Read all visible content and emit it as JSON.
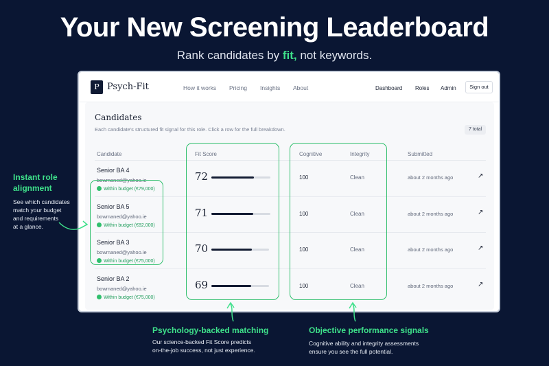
{
  "hero": {
    "title": "Your New Screening Leaderboard",
    "subtitle_pre": "Rank candidates by ",
    "subtitle_accent": "fit,",
    "subtitle_post": " not keywords."
  },
  "app": {
    "logo_letter": "P",
    "brand": "Psych-Fit",
    "nav_links": [
      "How it works",
      "Pricing",
      "Insights",
      "About"
    ],
    "nav_right": [
      "Dashboard",
      "Roles",
      "Admin"
    ],
    "signout_label": "Sign out"
  },
  "candidates": {
    "title": "Candidates",
    "description": "Each candidate's structured fit signal for this role. Click a row for the full breakdown.",
    "total_badge": "7 total",
    "headers": {
      "candidate": "Candidate",
      "fit_score": "Fit Score",
      "cognitive": "Cognitive",
      "integrity": "Integrity",
      "submitted": "Submitted"
    },
    "rows": [
      {
        "name": "Senior BA 4",
        "email": "bowmaned@yahoo.ie",
        "budget": "Within budget (€79,000)",
        "score": "72",
        "score_value": 72,
        "cognitive": "100",
        "integrity": "Clean",
        "submitted": "about 2 months ago",
        "arrow": "↗"
      },
      {
        "name": "Senior BA 5",
        "email": "bowmaned@yahoo.ie",
        "budget": "Within budget (€82,000)",
        "score": "71",
        "score_value": 71,
        "cognitive": "100",
        "integrity": "Clean",
        "submitted": "about 2 months ago",
        "arrow": "↗"
      },
      {
        "name": "Senior BA 3",
        "email": "bowmaned@yahoo.ie",
        "budget": "Within budget (€75,000)",
        "score": "70",
        "score_value": 70,
        "cognitive": "100",
        "integrity": "Clean",
        "submitted": "about 2 months ago",
        "arrow": "↗"
      },
      {
        "name": "Senior BA 2",
        "email": "bowmaned@yahoo.ie",
        "budget": "Within budget (€75,000)",
        "score": "69",
        "score_value": 69,
        "cognitive": "100",
        "integrity": "Clean",
        "submitted": "about 2 months ago",
        "arrow": "↗"
      }
    ]
  },
  "callouts": {
    "role_alignment": {
      "title_line1": "Instant role",
      "title_line2": "alignment",
      "text_lines": [
        "See which candidates",
        "match your budget",
        "and requirements",
        "at a glance."
      ]
    },
    "psychology": {
      "title": "Psychology-backed matching",
      "text_lines": [
        "Our science-backed Fit Score predicts",
        "on-the-job success, not just experience."
      ]
    },
    "performance": {
      "title": "Objective performance signals",
      "text_lines": [
        "Cognitive ability and integrity assessments",
        "ensure you see the full potential."
      ]
    }
  },
  "colors": {
    "background": "#0a1633",
    "accent": "#3ee08a",
    "highlight": "#2fbf6c",
    "bar": "#131c33"
  }
}
